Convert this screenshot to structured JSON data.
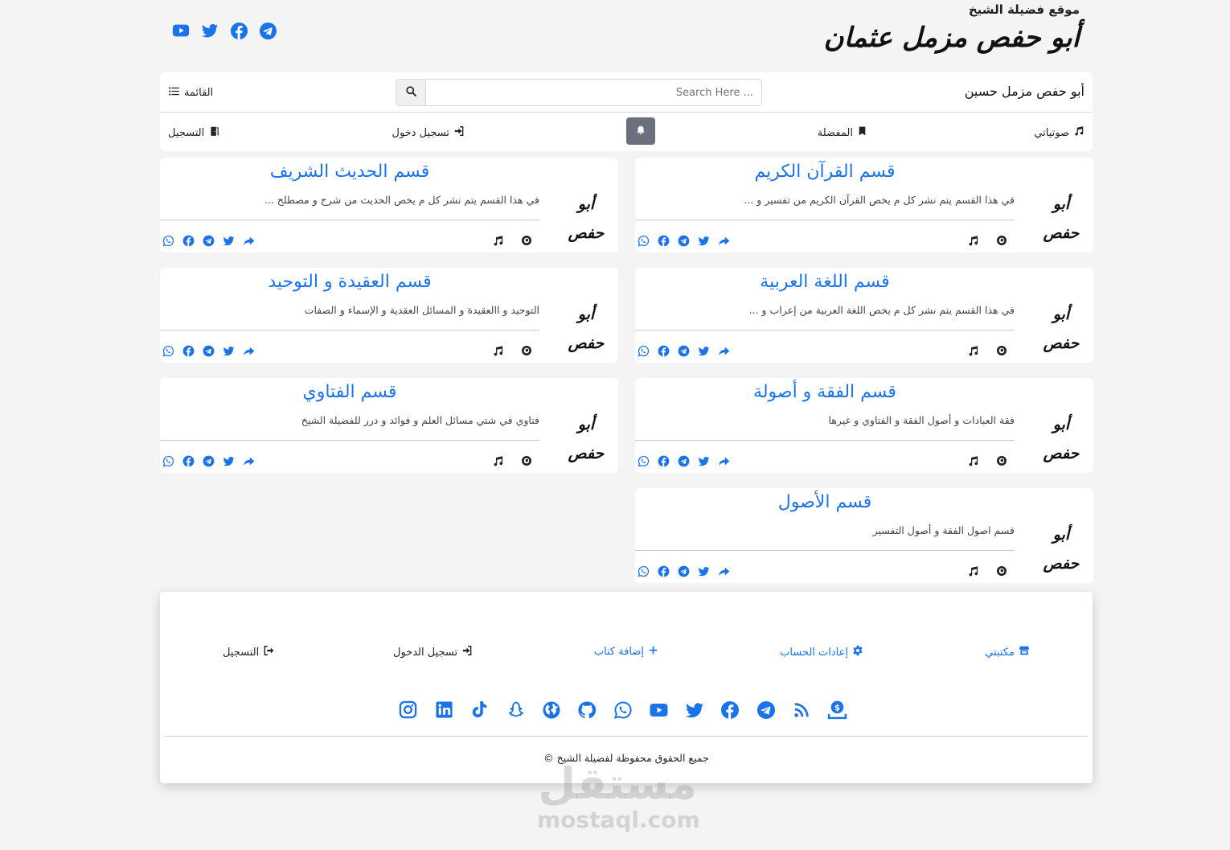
{
  "header": {
    "site_subtitle": "موقع فضيلة الشيخ",
    "calligraphy_name": "أبو حفص مزمل عثمان",
    "social_icons": [
      "youtube-icon",
      "twitter-icon",
      "facebook-icon",
      "telegram-icon"
    ]
  },
  "navbar": {
    "title": "أبو حفص مزمل حسين",
    "search_placeholder": "Search Here ...",
    "search_value": "",
    "menu_label": "القائمة",
    "items": {
      "audios": "صوتياتي",
      "favorites": "المفضلة",
      "login": "تسجيل دخول",
      "register": "التسجيل"
    }
  },
  "cards": [
    {
      "logo": "أبو حفص",
      "title": "قسم القرآن الكريم",
      "description": "في هذا القسم يتم نشر كل م يخص القرآن الكريم من تفسير و ..."
    },
    {
      "logo": "أبو حفص",
      "title": "قسم الحديث الشريف",
      "description": "في هذا القسم يتم نشر كل م يخص الحديث من شرح و مصطلح ..."
    },
    {
      "logo": "أبو حفص",
      "title": "قسم اللغة العربية",
      "description": "في هذا القسم يتم نشر كل م يخص اللغة العربية من إعراب و ..."
    },
    {
      "logo": "أبو حفص",
      "title": "قسم العقيدة و التوحيد",
      "description": "التوحيد و االعقيدة و المسائل العقدية و الإسماء و الصفات"
    },
    {
      "logo": "أبو حفص",
      "title": "قسم الفقة و أصولة",
      "description": "فقة العبادات و أصول الفقة و الفتاوي و غيرها"
    },
    {
      "logo": "أبو حفص",
      "title": "قسم الفتاوي",
      "description": "فتاوي في شتي مسائل العلم و فوائد و درر للفضيلة الشيخ"
    },
    {
      "logo": "أبو حفص",
      "title": "قسم الأصول",
      "description": "قسم اصول الفقة و أصول التفسير"
    }
  ],
  "card_share_icons": [
    "whatsapp-icon",
    "facebook-icon",
    "telegram-icon",
    "twitter-icon",
    "share-icon"
  ],
  "card_stat_icons": [
    "music-icon",
    "eye-icon"
  ],
  "footer": {
    "links": {
      "library": "مكتبتي",
      "account_settings": "إعادات الحساب",
      "add_book": "إضافة كتاب",
      "login": "تسجيل الدخول",
      "register": "التسجيل"
    },
    "social_icons": [
      "donate-icon",
      "rss-icon",
      "telegram-icon",
      "facebook-icon",
      "twitter-icon",
      "youtube-icon",
      "whatsapp-icon",
      "github-icon",
      "globe-icon",
      "snapchat-icon",
      "tiktok-icon",
      "linkedin-icon",
      "instagram-icon"
    ],
    "copyright": "جميع الحقوق محفوظة لفضيلة الشيخ ©"
  },
  "watermark": {
    "arabic": "مستقل",
    "latin": "mostaql.com"
  },
  "colors": {
    "accent": "#1a73e8",
    "background": "#f4f4f4",
    "bell_button": "#6c6f7d"
  }
}
